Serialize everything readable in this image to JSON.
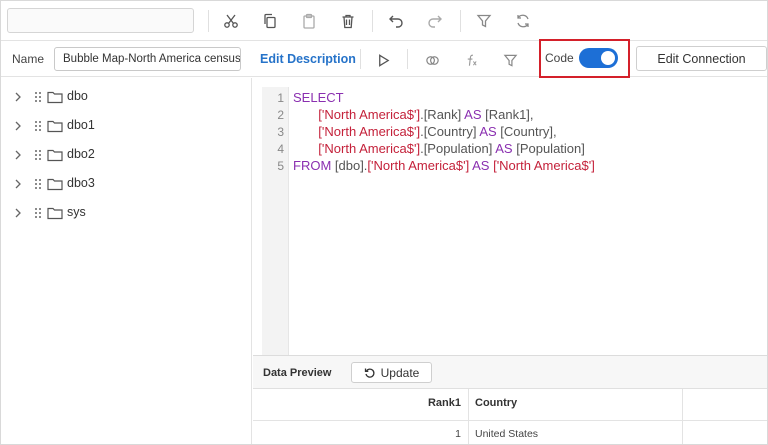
{
  "toolbar": {
    "search": {
      "value": "",
      "placeholder": ""
    },
    "icons": [
      "cut-icon",
      "copy-icon",
      "paste-icon",
      "delete-icon",
      "undo-icon",
      "redo-icon",
      "filter-icon",
      "refresh-icon"
    ]
  },
  "namebar": {
    "name_label": "Name",
    "name_value": "Bubble Map-North America census da",
    "edit_description": "Edit Description",
    "code_label": "Code",
    "code_enabled": true,
    "edit_connection": "Edit Connection",
    "icons": [
      "play-icon",
      "link-icon",
      "function-icon",
      "filter-icon"
    ]
  },
  "tree": {
    "items": [
      {
        "label": "dbo"
      },
      {
        "label": "dbo1"
      },
      {
        "label": "dbo2"
      },
      {
        "label": "dbo3"
      },
      {
        "label": "sys"
      }
    ]
  },
  "editor": {
    "line_numbers": [
      "1",
      "2",
      "3",
      "4",
      "5"
    ],
    "lines": [
      [
        {
          "t": "SELECT",
          "c": "kw"
        }
      ],
      [
        {
          "t": "       ",
          "c": "id"
        },
        {
          "t": "['North America$']",
          "c": "str"
        },
        {
          "t": ".[Rank] ",
          "c": "id"
        },
        {
          "t": "AS",
          "c": "kw"
        },
        {
          "t": " [Rank1],",
          "c": "id"
        }
      ],
      [
        {
          "t": "       ",
          "c": "id"
        },
        {
          "t": "['North America$']",
          "c": "str"
        },
        {
          "t": ".[Country] ",
          "c": "id"
        },
        {
          "t": "AS",
          "c": "kw"
        },
        {
          "t": " [Country],",
          "c": "id"
        }
      ],
      [
        {
          "t": "       ",
          "c": "id"
        },
        {
          "t": "['North America$']",
          "c": "str"
        },
        {
          "t": ".[Population] ",
          "c": "id"
        },
        {
          "t": "AS",
          "c": "kw"
        },
        {
          "t": " [Population]",
          "c": "id"
        }
      ],
      [
        {
          "t": "FROM",
          "c": "kw"
        },
        {
          "t": " [dbo].",
          "c": "id"
        },
        {
          "t": "['North America$']",
          "c": "str"
        },
        {
          "t": " ",
          "c": "id"
        },
        {
          "t": "AS",
          "c": "kw"
        },
        {
          "t": " ",
          "c": "id"
        },
        {
          "t": "['North America$']",
          "c": "str"
        }
      ]
    ]
  },
  "preview": {
    "title": "Data Preview",
    "update_label": "Update",
    "columns": [
      "Rank1",
      "Country"
    ],
    "rows": [
      [
        "1",
        "United States"
      ]
    ]
  },
  "colors": {
    "accent": "#1d6fd6",
    "link": "#2673c9",
    "highlight_box": "#d4202a",
    "keyword": "#8a2fb0",
    "string": "#c4213a"
  }
}
